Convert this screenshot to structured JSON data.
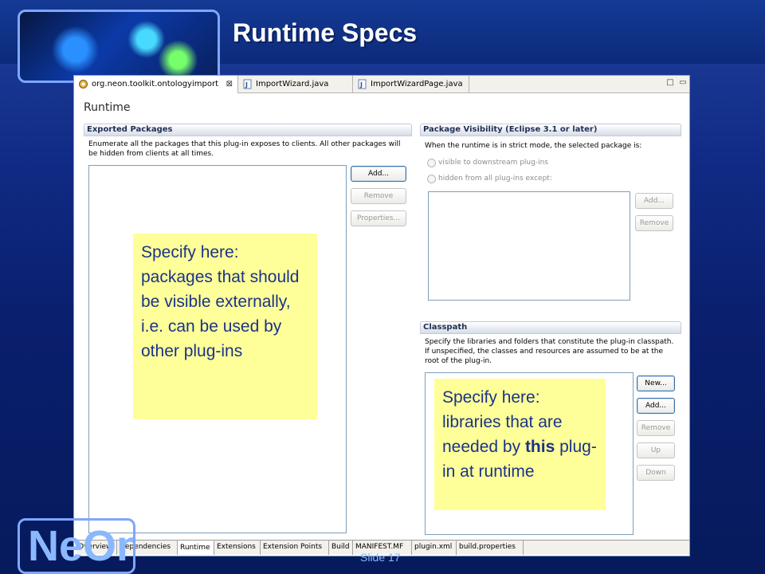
{
  "slide": {
    "title": "Runtime Specs",
    "footer_logo_text": "NeOn",
    "slide_number": "Slide 17"
  },
  "editor": {
    "tabs": [
      {
        "label": "org.neon.toolkit.ontologyimport",
        "icon": "plugin-icon",
        "active": true,
        "close": "⊠"
      },
      {
        "label": "ImportWizard.java",
        "icon": "java-file-icon",
        "active": false
      },
      {
        "label": "ImportWizardPage.java",
        "icon": "java-file-icon",
        "active": false
      }
    ],
    "window_controls": {
      "minimize": "□",
      "maximize": "▭"
    }
  },
  "form": {
    "title": "Runtime"
  },
  "exported_packages": {
    "header": "Exported Packages",
    "description": "Enumerate all the packages that this plug-in exposes to clients.  All other packages will be hidden from clients at all times.",
    "buttons": {
      "add": "Add...",
      "remove": "Remove",
      "properties": "Properties..."
    }
  },
  "package_visibility": {
    "header": "Package Visibility (Eclipse 3.1 or later)",
    "description": "When the runtime is in strict mode, the selected package is:",
    "radio_downstream": "visible to downstream plug-ins",
    "radio_hidden": "hidden from all plug-ins except:",
    "buttons": {
      "add": "Add...",
      "remove": "Remove"
    }
  },
  "classpath": {
    "header": "Classpath",
    "description": "Specify the libraries and folders that constitute the plug-in classpath.  If unspecified, the classes and resources are assumed to be at the root of the plug-in.",
    "buttons": {
      "new": "New...",
      "add": "Add...",
      "remove": "Remove",
      "up": "Up",
      "down": "Down"
    }
  },
  "bottom_tabs": [
    {
      "label": "Overview"
    },
    {
      "label": "Dependencies"
    },
    {
      "label": "Runtime",
      "active": true
    },
    {
      "label": "Extensions"
    },
    {
      "label": "Extension Points"
    },
    {
      "label": "Build"
    },
    {
      "label": "MANIFEST.MF"
    },
    {
      "label": "plugin.xml"
    },
    {
      "label": "build.properties"
    }
  ],
  "callouts": {
    "left": "Specify here:\npackages that should be visible externally, i.e. can be used by other plug-ins",
    "right_before": "Specify here: libraries that are needed by ",
    "right_bold": "this",
    "right_after": " plug-in at runtime"
  },
  "colors": {
    "slide_bg": "#0a1f6e",
    "callout_bg": "#ffff99",
    "callout_text": "#1a3388",
    "section_header_text": "#1f2f55"
  }
}
